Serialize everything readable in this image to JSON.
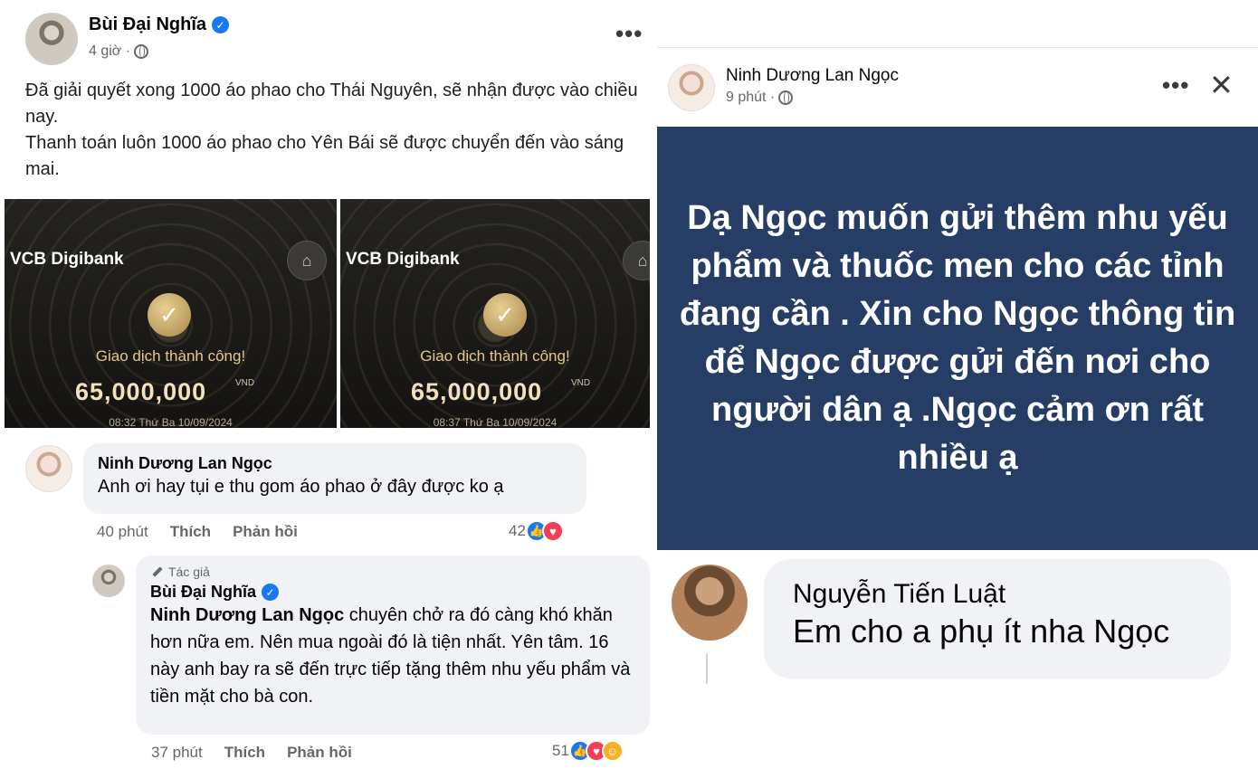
{
  "left_post": {
    "author": "Bùi Đại Nghĩa",
    "time": "4 giờ ·",
    "more": "•••",
    "text_lines": [
      "Đã giải quyết xong 1000 áo phao cho Thái Nguyên, sẽ nhận được vào chiều nay.",
      "Thanh toán luôn 1000 áo phao cho Yên Bái sẽ được chuyển đến vào sáng mai."
    ],
    "receipts": [
      {
        "brand": "VCB Digibank",
        "status": "Giao dịch thành công!",
        "amount": "65,000,000",
        "currency": "VND",
        "time": "08:32 Thứ Ba 10/09/2024"
      },
      {
        "brand": "VCB Digibank",
        "status": "Giao dịch thành công!",
        "amount": "65,000,000",
        "currency": "VND",
        "time": "08:37 Thứ Ba 10/09/2024"
      }
    ],
    "comment1": {
      "author": "Ninh Dương Lan Ngọc",
      "text": "Anh ơi hay tụi e thu gom áo phao ở đây được ko ạ",
      "time": "40 phút",
      "like": "Thích",
      "reply": "Phản hồi",
      "reactions": "42"
    },
    "reply1": {
      "tag": "Tác giả",
      "author": "Bùi Đại Nghĩa",
      "mention": "Ninh Dương Lan Ngọc",
      "text": " chuyên chở ra đó càng khó khăn hơn nữa em. Nên mua ngoài đó là tiện nhất. Yên tâm. 16 này anh bay ra sẽ đến trực tiếp tặng thêm nhu yếu phẩm và tiền mặt cho bà con.",
      "time": "37 phút",
      "like": "Thích",
      "reply": "Phản hồi",
      "reactions": "51"
    }
  },
  "right_post": {
    "author": "Ninh Dương Lan Ngọc",
    "time": "9 phút ·",
    "more": "•••",
    "close": "✕",
    "announcement": "Dạ Ngọc muốn gửi thêm nhu yếu phẩm và thuốc men cho các tỉnh đang cần . Xin cho Ngọc thông tin để Ngọc được gửi đến nơi cho người dân ạ .Ngọc cảm ơn rất nhiều ạ",
    "comment": {
      "author": "Nguyễn Tiến Luật",
      "text": "Em cho a phụ ít nha Ngọc"
    }
  },
  "icons": {
    "verified": "verified-badge-icon",
    "globe": "globe-icon",
    "check": "check-icon",
    "home": "home-icon",
    "pen": "pen-icon",
    "like": "like-reaction-icon",
    "love": "love-reaction-icon",
    "care": "care-reaction-icon"
  },
  "colors": {
    "facebook_blue": "#1877f2",
    "announcement_bg": "#263e66",
    "receipt_gold": "#e2c78c"
  }
}
